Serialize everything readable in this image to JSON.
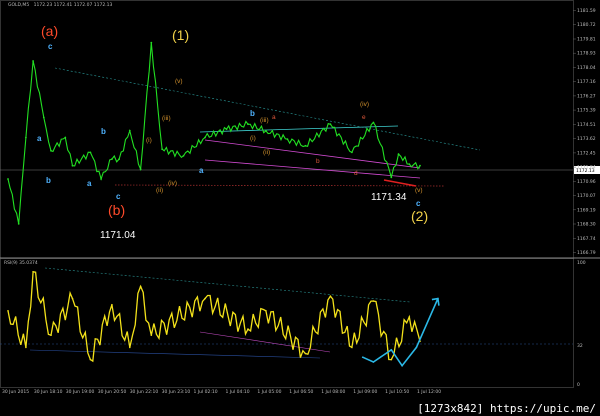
{
  "header": {
    "symbol_label": "GOLD,M5",
    "ohlc": "1172.23 1172.41 1172.07 1172.13",
    "indicator_label": "RSI(9) 35.0374"
  },
  "price_axis_labels": [
    "1181.59",
    "1180.72",
    "1179.81",
    "1178.93",
    "1178.04",
    "1177.16",
    "1176.27",
    "1175.39",
    "1174.51",
    "1173.62",
    "1172.45",
    "1171.84",
    "1170.96",
    "1170.07",
    "1169.19",
    "1168.30",
    "1167.74",
    "1166.79"
  ],
  "current_price_label": "1172.13",
  "rsi_axis_labels": [
    "100",
    "32",
    "0"
  ],
  "time_axis_labels": [
    "30 Jun 2015",
    "30 Jun 18:10",
    "30 Jun 19:00",
    "30 Jun 20:50",
    "30 Jun 22:10",
    "30 Jun 23:10",
    "1 Jul 02:10",
    "1 Jul 04:10",
    "1 Jul 05:00",
    "1 Jul 06:50",
    "1 Jul 08:00",
    "1 Jul 09:00",
    "1 Jul 10:50",
    "1 Jul 12:00"
  ],
  "annotations": {
    "wave_a": "(a)",
    "wave_b": "(b)",
    "wave_1": "(1)",
    "wave_2": "(2)",
    "low_b_price": "1171.04",
    "low_2_price": "1171.34",
    "blue_labels": [
      "c",
      "a",
      "b",
      "a",
      "c",
      "a",
      "b",
      "c"
    ],
    "orange_labels": [
      "(v)",
      "(iii)",
      "(i)",
      "(ii)",
      "(iv)",
      "(ii)",
      "(iii)",
      "(i)",
      "(iv)",
      "(v)"
    ],
    "red_labels": [
      "a",
      "b",
      "d",
      "e"
    ]
  },
  "colors": {
    "price_line": "#22e022",
    "rsi_line": "#f3e21a",
    "projection": "#2bb8e6",
    "trend_cyan": "#3fd0d0",
    "trend_magenta": "#d24bd2",
    "support_red": "#e02020"
  },
  "chart_data": [
    {
      "type": "line",
      "title": "GOLD,M5",
      "series": [
        {
          "name": "GOLD,M5",
          "x": [
            "30 Jun 17:00",
            "30 Jun 17:30",
            "30 Jun 17:50",
            "30 Jun 18:10",
            "30 Jun 18:40",
            "30 Jun 19:00",
            "30 Jun 19:40",
            "30 Jun 20:00",
            "30 Jun 20:50",
            "30 Jun 21:20",
            "30 Jun 21:50",
            "30 Jun 22:10",
            "30 Jun 22:40",
            "30 Jun 23:10",
            "30 Jun 23:40",
            "1 Jul 00:10",
            "1 Jul 01:10",
            "1 Jul 02:10",
            "1 Jul 03:10",
            "1 Jul 04:10",
            "1 Jul 05:00",
            "1 Jul 06:00",
            "1 Jul 06:50",
            "1 Jul 08:00",
            "1 Jul 09:00",
            "1 Jul 10:00",
            "1 Jul 10:50",
            "1 Jul 11:10",
            "1 Jul 11:40",
            "1 Jul 12:10"
          ],
          "y": [
            1171.3,
            1168.6,
            1173.8,
            1178.4,
            1175.0,
            1173.0,
            1173.8,
            1172.1,
            1172.9,
            1171.3,
            1172.5,
            1172.5,
            1174.2,
            1171.9,
            1179.5,
            1173.1,
            1172.7,
            1173.8,
            1174.3,
            1174.6,
            1174.2,
            1173.7,
            1173.3,
            1174.6,
            1172.9,
            1174.7,
            1171.4,
            1172.8,
            1172.2,
            1172.1
          ]
        }
      ],
      "ylim": [
        1166.79,
        1181.59
      ]
    },
    {
      "type": "line",
      "title": "RSI(9) 35.0374",
      "series": [
        {
          "name": "RSI(9)",
          "x": [
            "30 Jun 17:00",
            "30 Jun 17:50",
            "30 Jun 18:10",
            "30 Jun 19:00",
            "30 Jun 20:00",
            "30 Jun 20:50",
            "30 Jun 21:50",
            "30 Jun 22:40",
            "30 Jun 23:10",
            "30 Jun 23:40",
            "1 Jul 02:10",
            "1 Jul 04:10",
            "1 Jul 05:00",
            "1 Jul 06:50",
            "1 Jul 08:00",
            "1 Jul 09:00",
            "1 Jul 10:00",
            "1 Jul 10:50",
            "1 Jul 11:40",
            "1 Jul 12:10"
          ],
          "y": [
            60,
            30,
            92,
            40,
            70,
            20,
            65,
            30,
            80,
            40,
            70,
            45,
            60,
            25,
            72,
            30,
            68,
            20,
            55,
            35
          ]
        },
        {
          "name": "projection",
          "x": [
            "1 Jul 09:30",
            "1 Jul 10:00",
            "1 Jul 10:50",
            "1 Jul 11:20",
            "1 Jul 12:00",
            "1 Jul 13:00"
          ],
          "y": [
            22,
            18,
            28,
            15,
            30,
            70
          ]
        }
      ],
      "ylim": [
        0,
        100
      ]
    }
  ]
}
